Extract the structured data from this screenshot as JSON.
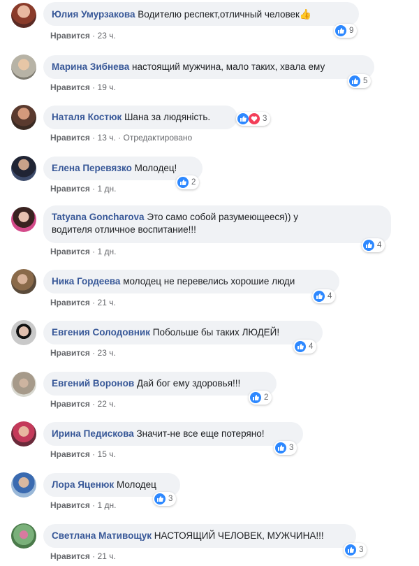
{
  "ui": {
    "like_label": "Нравится",
    "dot": "·"
  },
  "comments": [
    {
      "author": "Юлия Умурзакова",
      "text": "Водителю респект,отличный человек",
      "emoji": "👍",
      "time": "23 ч.",
      "reactions": "9"
    },
    {
      "author": "Марина Зибнева",
      "text": "настоящий мужчина, мало таких, хвала ему",
      "time": "19 ч.",
      "reactions": "5"
    },
    {
      "author": "Наталя Костюк",
      "text": "Шана за людяність.",
      "time": "13 ч.",
      "edited": "Отредактировано",
      "reactions": "3"
    },
    {
      "author": "Елена Перевязко",
      "text": "Молодец!",
      "time": "1 дн.",
      "reactions": "2"
    },
    {
      "author": "Tatyana Goncharova",
      "text": "Это само собой разумеющееся)) у",
      "text2": "водителя отличное воспитание!!!",
      "time": "1 дн.",
      "reactions": "4"
    },
    {
      "author": "Ника Гордеева",
      "text": "молодец не перевелись хорошие люди",
      "time": "21 ч.",
      "reactions": "4"
    },
    {
      "author": "Евгения Солодовник",
      "text": "Побольше бы таких ЛЮДЕЙ!",
      "time": "23 ч.",
      "reactions": "4"
    },
    {
      "author": "Евгений Воронов",
      "text": "Дай бог ему здоровья!!!",
      "time": "22 ч.",
      "reactions": "2"
    },
    {
      "author": "Ирина Педискова",
      "text": "Значит-не все еще потеряно!",
      "time": "15 ч.",
      "reactions": "3"
    },
    {
      "author": "Лора Яценюк",
      "text": "Молодец",
      "time": "1 дн.",
      "reactions": "3"
    },
    {
      "author": "Светлана Мативощук",
      "text": "НАСТОЯЩИЙ ЧЕЛОВЕК, МУЖЧИНА!!!",
      "time": "21 ч.",
      "reactions": "3"
    }
  ]
}
